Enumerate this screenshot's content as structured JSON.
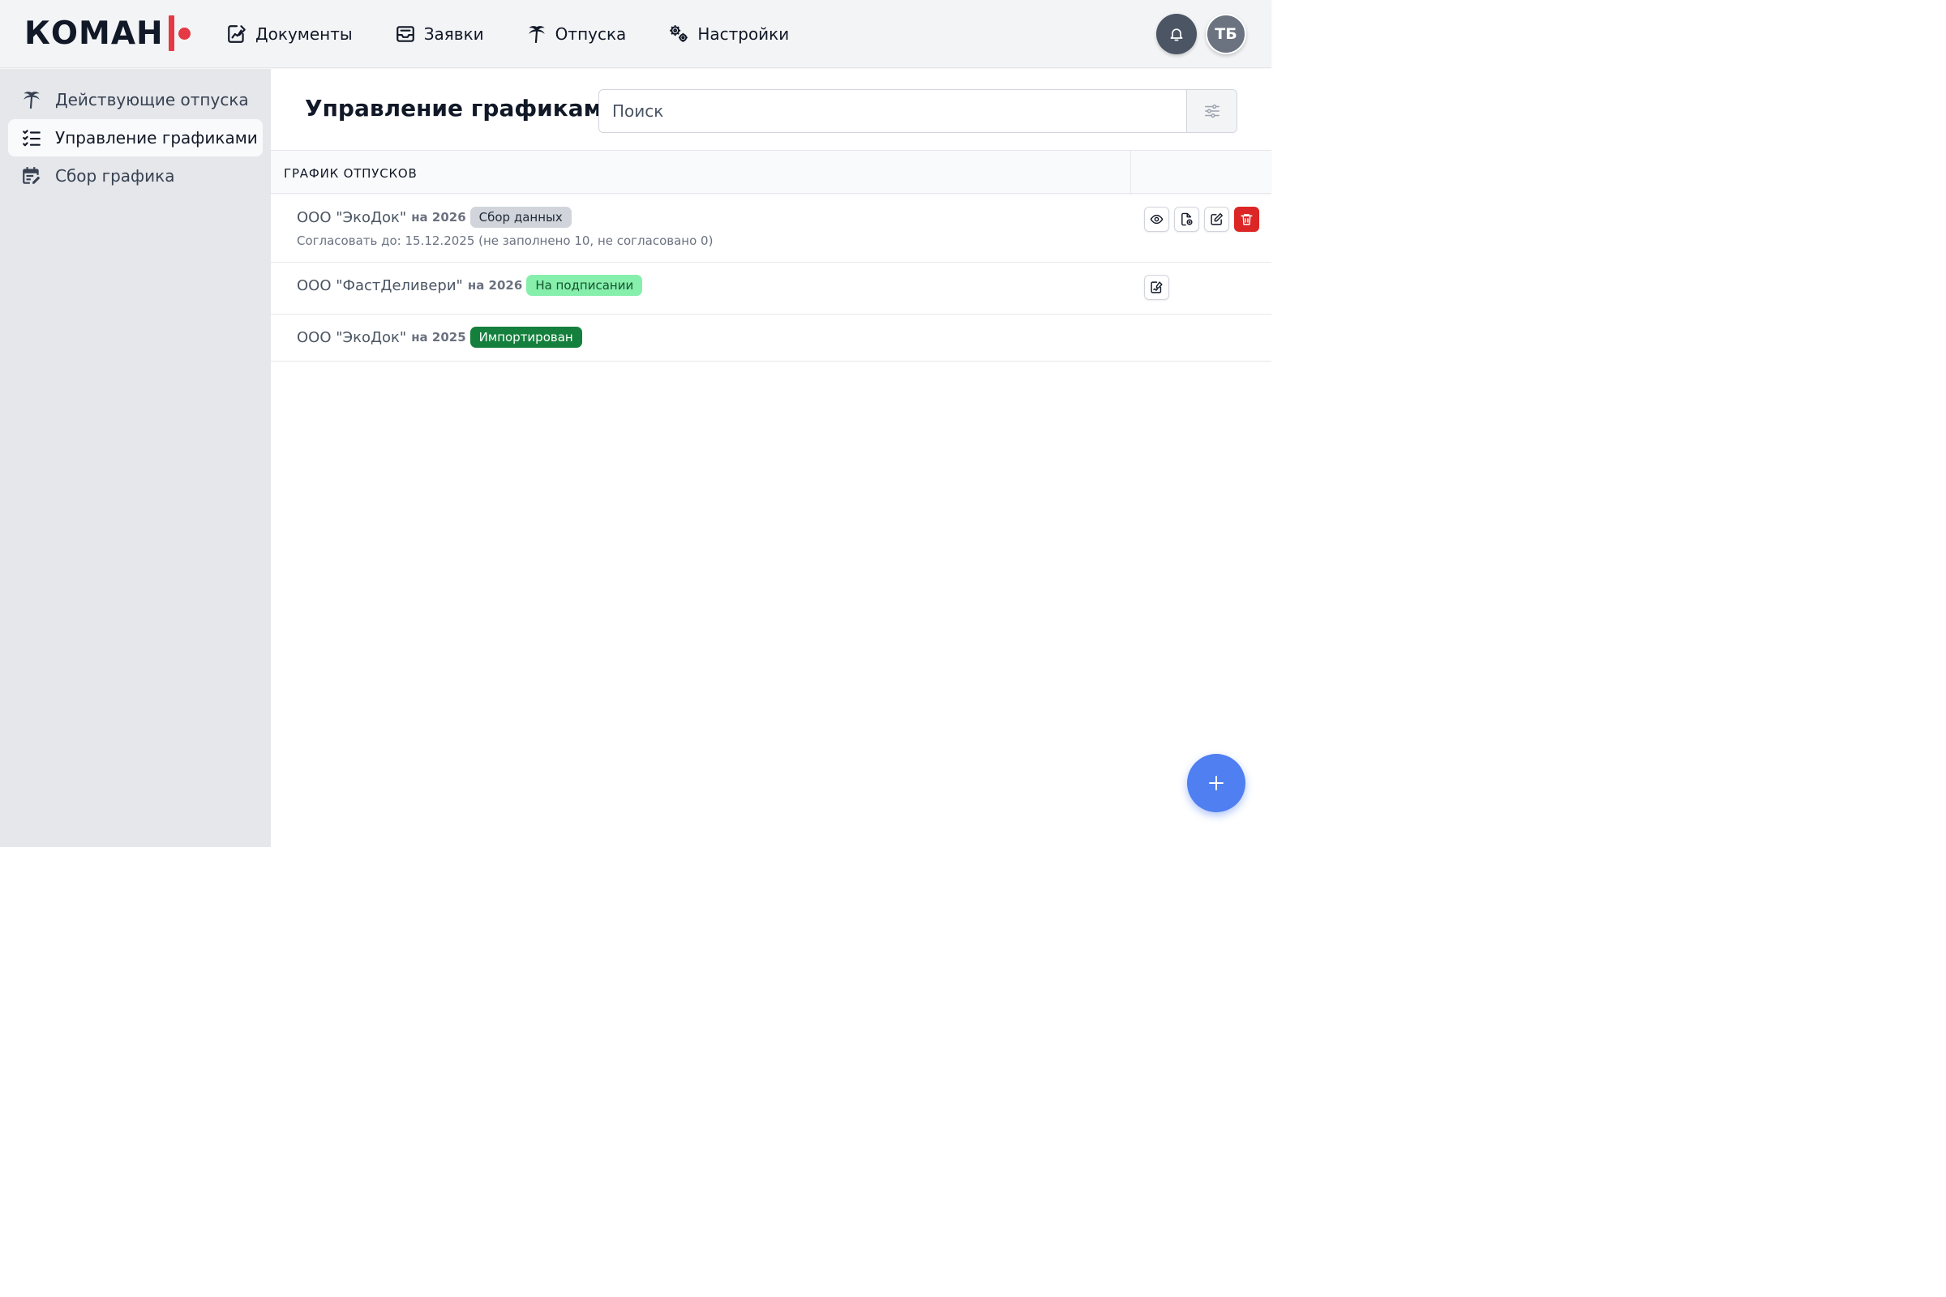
{
  "header": {
    "logo_text": "КОМАН",
    "nav": [
      {
        "label": "Документы",
        "icon": "document-chart-icon"
      },
      {
        "label": "Заявки",
        "icon": "inbox-icon"
      },
      {
        "label": "Отпуска",
        "icon": "palm-tree-icon"
      },
      {
        "label": "Настройки",
        "icon": "gears-icon"
      }
    ],
    "avatar_initials": "ТБ",
    "accent_color": "#e53945"
  },
  "sidebar": {
    "items": [
      {
        "label": "Действующие отпуска",
        "icon": "palm-tree-icon",
        "active": false
      },
      {
        "label": "Управление графиками",
        "icon": "checklist-icon",
        "active": true
      },
      {
        "label": "Сбор графика",
        "icon": "calendar-edit-icon",
        "active": false
      }
    ]
  },
  "main": {
    "title": "Управление графиками",
    "search": {
      "placeholder": "Поиск",
      "value": ""
    },
    "table": {
      "column_header": "ГРАФИК ОТПУСКОВ",
      "rows": [
        {
          "org": "ООО \"ЭкоДок\"",
          "year": "на 2026",
          "status": "Сбор данных",
          "status_color": "#d1d5db",
          "subtitle": "Согласовать до: 15.12.2025 (не заполнено 10, не согласовано 0)",
          "actions": [
            "eye-icon",
            "document-add-icon",
            "edit-icon",
            "trash-icon"
          ]
        },
        {
          "org": "ООО \"ФастДеливери\"",
          "year": "на 2026",
          "status": "На подписании",
          "status_color": "#86efac",
          "actions": [
            "document-sign-icon"
          ]
        },
        {
          "org": "ООО \"ЭкоДок\"",
          "year": "на 2025",
          "status": "Импортирован",
          "status_color": "#15803d",
          "actions": []
        }
      ]
    },
    "fab_color": "#4f7ff0"
  }
}
